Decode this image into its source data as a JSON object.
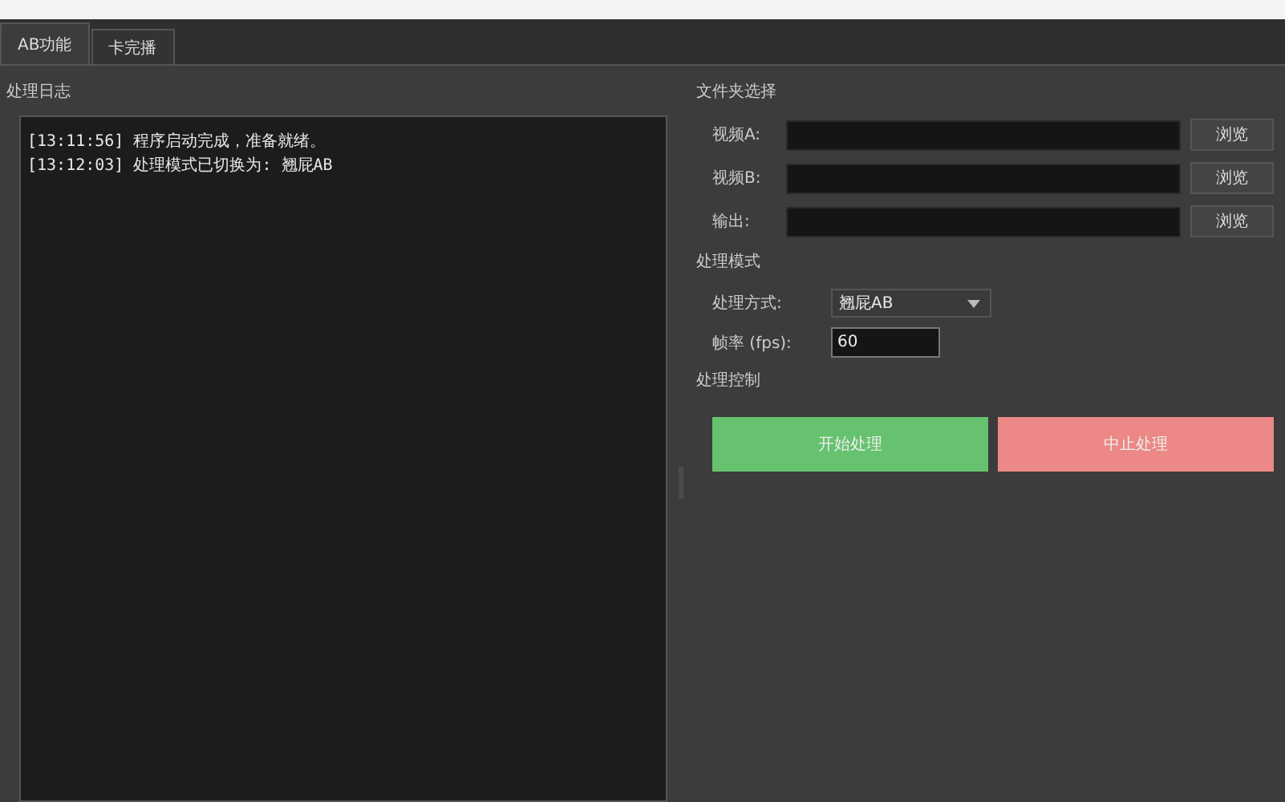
{
  "tabs": [
    {
      "label": "AB功能",
      "selected": true
    },
    {
      "label": "卡完播",
      "selected": false
    }
  ],
  "log": {
    "title": "处理日志",
    "lines": [
      "[13:11:56] 程序启动完成，准备就绪。",
      "[13:12:03] 处理模式已切换为: 翘屁AB"
    ]
  },
  "files": {
    "title": "文件夹选择",
    "rows": [
      {
        "label": "视频A:",
        "button": "浏览"
      },
      {
        "label": "视频B:",
        "button": "浏览"
      },
      {
        "label": "输出:",
        "button": "浏览"
      }
    ]
  },
  "mode": {
    "title": "处理模式",
    "method_label": "处理方式:",
    "method_value": "翘屁AB",
    "fps_label": "帧率 (fps):",
    "fps_value": "60"
  },
  "control": {
    "title": "处理控制",
    "buttons": [
      {
        "label": "开始处理",
        "kind": "start"
      },
      {
        "label": "中止处理",
        "kind": "stop"
      }
    ]
  }
}
